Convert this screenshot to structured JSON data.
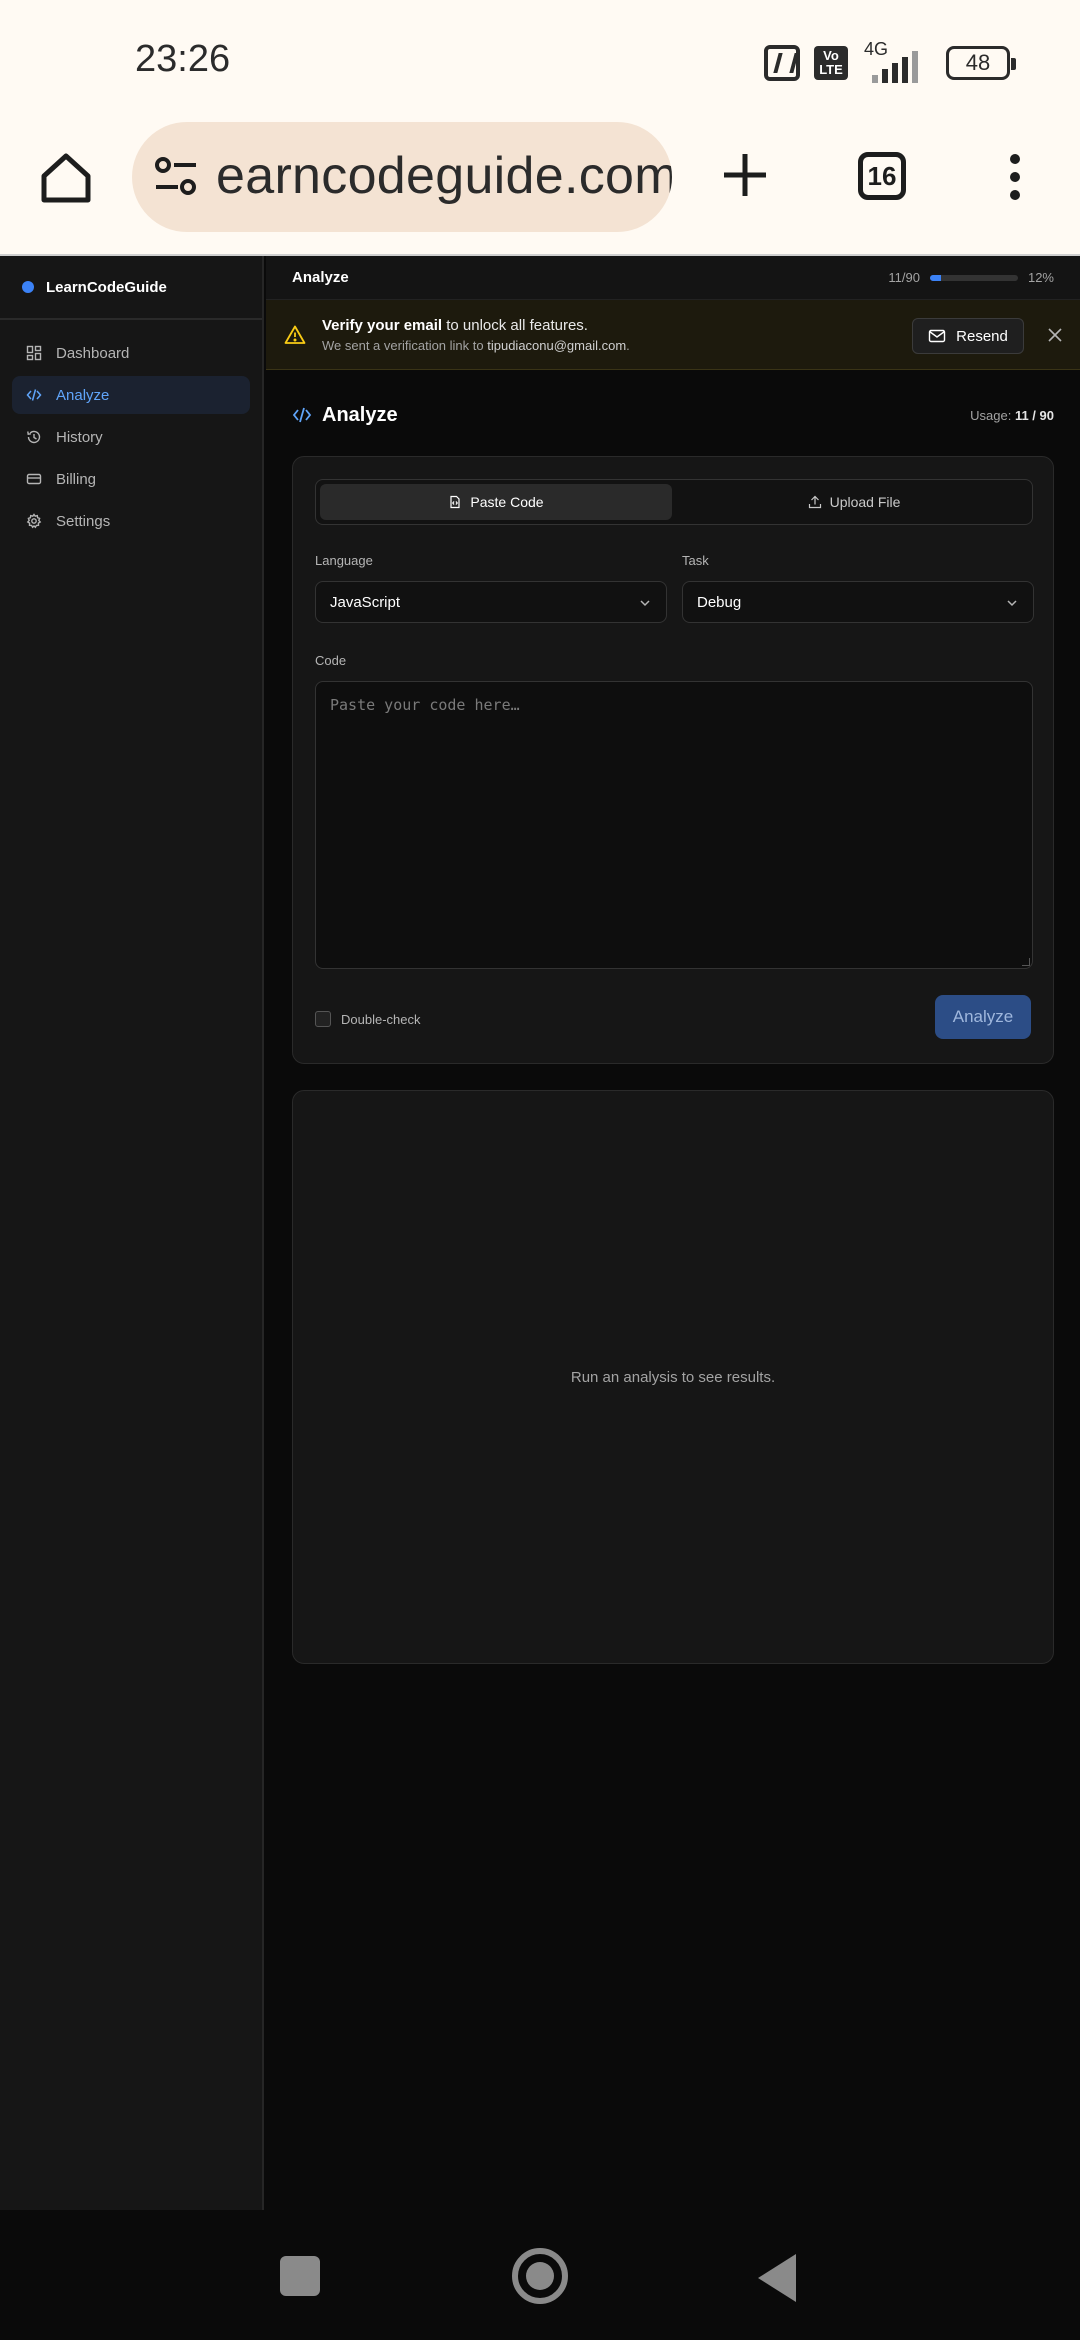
{
  "status_bar": {
    "time": "23:26",
    "volte": "Vo LTE",
    "network": "4G",
    "battery": "48"
  },
  "browser": {
    "url_text": "earncodeguide.com",
    "tab_count": "16"
  },
  "sidebar": {
    "brand": "LearnCodeGuide",
    "items": [
      {
        "label": "Dashboard",
        "icon": "dashboard-icon"
      },
      {
        "label": "Analyze",
        "icon": "code-icon",
        "active": true
      },
      {
        "label": "History",
        "icon": "history-icon"
      },
      {
        "label": "Billing",
        "icon": "card-icon"
      },
      {
        "label": "Settings",
        "icon": "gear-icon"
      }
    ]
  },
  "topbar": {
    "title": "Analyze",
    "usage_text": "11/90",
    "usage_percent_text": "12%",
    "usage_fraction": 0.12
  },
  "banner": {
    "title_strong": "Verify your email",
    "title_rest": " to unlock all features.",
    "sub_prefix": "We sent a verification link to ",
    "email": "tipudiaconu@gmail.com",
    "sub_suffix": ".",
    "resend_label": "Resend"
  },
  "page": {
    "title": "Analyze",
    "usage_label": "Usage: ",
    "usage_value": "11 / 90"
  },
  "form": {
    "tabs": [
      {
        "label": "Paste Code",
        "active": true
      },
      {
        "label": "Upload File"
      }
    ],
    "language_label": "Language",
    "language_value": "JavaScript",
    "task_label": "Task",
    "task_value": "Debug",
    "code_label": "Code",
    "code_placeholder": "Paste your code here…",
    "double_check_label": "Double-check",
    "analyze_label": "Analyze"
  },
  "results": {
    "empty_text": "Run an analysis to see results."
  },
  "colors": {
    "accent": "#3b82f6",
    "warning": "#facc15"
  }
}
